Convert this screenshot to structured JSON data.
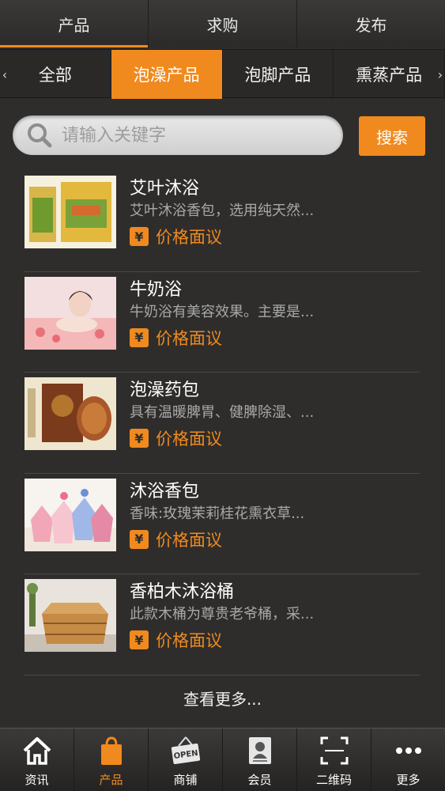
{
  "top_tabs": [
    {
      "label": "产品",
      "active": true
    },
    {
      "label": "求购",
      "active": false
    },
    {
      "label": "发布",
      "active": false
    }
  ],
  "categories": {
    "left_arrow": "‹",
    "right_arrow": "›",
    "items": [
      {
        "label": "全部",
        "active": false
      },
      {
        "label": "泡澡产品",
        "active": true
      },
      {
        "label": "泡脚产品",
        "active": false
      },
      {
        "label": "熏蒸产品",
        "active": false
      }
    ]
  },
  "search": {
    "placeholder": "请输入关键字",
    "button_label": "搜索"
  },
  "products": [
    {
      "title": "艾叶沐浴",
      "desc": "艾叶沐浴香包，选用纯天然...",
      "price_icon": "¥",
      "price": "价格面议"
    },
    {
      "title": "牛奶浴",
      "desc": "牛奶浴有美容效果。主要是...",
      "price_icon": "¥",
      "price": "价格面议"
    },
    {
      "title": "泡澡药包",
      "desc": "具有温暖脾胃、健脾除湿、...",
      "price_icon": "¥",
      "price": "价格面议"
    },
    {
      "title": "沐浴香包",
      "desc": "香味:玫瑰茉莉桂花熏衣草...",
      "price_icon": "¥",
      "price": "价格面议"
    },
    {
      "title": "香柏木沐浴桶",
      "desc": "此款木桶为尊贵老爷桶，采...",
      "price_icon": "¥",
      "price": "价格面议"
    }
  ],
  "more_label": "查看更多...",
  "bottom_nav": [
    {
      "label": "资讯",
      "icon": "home-icon",
      "active": false
    },
    {
      "label": "产品",
      "icon": "shopping-bag-icon",
      "active": true
    },
    {
      "label": "商铺",
      "icon": "open-sign-icon",
      "open_text": "OPEN",
      "active": false
    },
    {
      "label": "会员",
      "icon": "member-card-icon",
      "active": false
    },
    {
      "label": "二维码",
      "icon": "qr-scan-icon",
      "active": false
    },
    {
      "label": "更多",
      "icon": "more-dots-icon",
      "active": false
    }
  ],
  "colors": {
    "accent": "#f08a1e",
    "background": "#2e2d2c"
  }
}
